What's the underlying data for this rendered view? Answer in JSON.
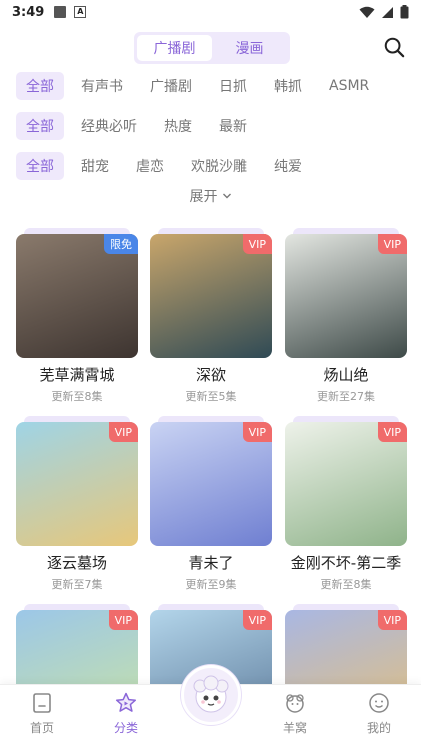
{
  "status_bar": {
    "time": "3:49"
  },
  "header": {
    "tabs": [
      {
        "label": "广播剧",
        "active": true
      },
      {
        "label": "漫画",
        "active": false
      }
    ]
  },
  "filters": {
    "row1": [
      "全部",
      "有声书",
      "广播剧",
      "日抓",
      "韩抓",
      "ASMR"
    ],
    "row2": [
      "全部",
      "经典必听",
      "热度",
      "最新"
    ],
    "row3": [
      "全部",
      "甜宠",
      "虐恋",
      "欢脱沙雕",
      "纯爱"
    ],
    "expand_label": "展开"
  },
  "cards": [
    {
      "title": "芜草满霄城",
      "subtitle": "更新至8集",
      "badge": "限免",
      "badge_type": "free",
      "colors": [
        "#7a6a5e",
        "#3d3430"
      ]
    },
    {
      "title": "深欲",
      "subtitle": "更新至5集",
      "badge": "VIP",
      "badge_type": "vip",
      "colors": [
        "#c9a66b",
        "#2f4a55"
      ]
    },
    {
      "title": "炀山绝",
      "subtitle": "更新至27集",
      "badge": "VIP",
      "badge_type": "vip",
      "colors": [
        "#d9ddd8",
        "#3e4a48"
      ]
    },
    {
      "title": "逐云墓场",
      "subtitle": "更新至7集",
      "badge": "VIP",
      "badge_type": "vip",
      "colors": [
        "#9fd4e6",
        "#e7c77a"
      ]
    },
    {
      "title": "青未了",
      "subtitle": "更新至9集",
      "badge": "VIP",
      "badge_type": "vip",
      "colors": [
        "#b9c6f0",
        "#6f7fd1"
      ]
    },
    {
      "title": "金刚不坏-第二季",
      "subtitle": "更新至8集",
      "badge": "VIP",
      "badge_type": "vip",
      "colors": [
        "#e9efe4",
        "#8fb38a"
      ]
    },
    {
      "title": "",
      "subtitle": "",
      "badge": "VIP",
      "badge_type": "vip",
      "colors": [
        "#9cc7e8",
        "#c9e3a4"
      ]
    },
    {
      "title": "",
      "subtitle": "",
      "badge": "VIP",
      "badge_type": "vip",
      "colors": [
        "#9fc9e4",
        "#5c7a9a"
      ]
    },
    {
      "title": "",
      "subtitle": "",
      "badge": "VIP",
      "badge_type": "vip",
      "colors": [
        "#a9b7e3",
        "#e4c07a"
      ]
    }
  ],
  "bottom_nav": [
    {
      "label": "首页",
      "icon": "home-icon",
      "active": false
    },
    {
      "label": "分类",
      "icon": "category-icon",
      "active": true
    },
    {
      "label": "羊窝",
      "icon": "sheep-nest-icon",
      "active": false
    },
    {
      "label": "我的",
      "icon": "profile-icon",
      "active": false
    }
  ],
  "colors": {
    "accent": "#8a66d8",
    "accent_bg": "#efe9fb",
    "vip": "#f06b6b",
    "free": "#4a86e8"
  }
}
